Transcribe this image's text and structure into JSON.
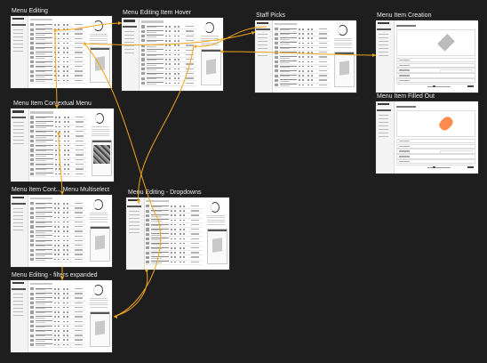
{
  "canvas": {
    "background": "#1e1e1e",
    "connector_color": "#f3a51b"
  },
  "frames": [
    {
      "id": "menu-editing",
      "title": "Menu Editing",
      "variant": "list"
    },
    {
      "id": "menu-editing-item-hover",
      "title": "Menu Editing Item Hover",
      "variant": "list"
    },
    {
      "id": "staff-picks",
      "title": "Staff Picks",
      "variant": "list"
    },
    {
      "id": "menu-item-creation",
      "title": "Menu Item Creation",
      "variant": "form"
    },
    {
      "id": "menu-item-filled-out",
      "title": "Menu Item Filled Out",
      "variant": "form-filled"
    },
    {
      "id": "menu-item-contextual-menu",
      "title": "Menu Item Contextual Menu",
      "variant": "list-photo"
    },
    {
      "id": "menu-item-cont-multiselect",
      "title": "Menu Item Cont... Menu Multiselect",
      "variant": "list"
    },
    {
      "id": "menu-editing-dropdowns",
      "title": "Menu Editing - Dropdowns",
      "variant": "list"
    },
    {
      "id": "menu-editing-filters-expanded",
      "title": "Menu Editing - filters expanded",
      "variant": "list"
    }
  ]
}
